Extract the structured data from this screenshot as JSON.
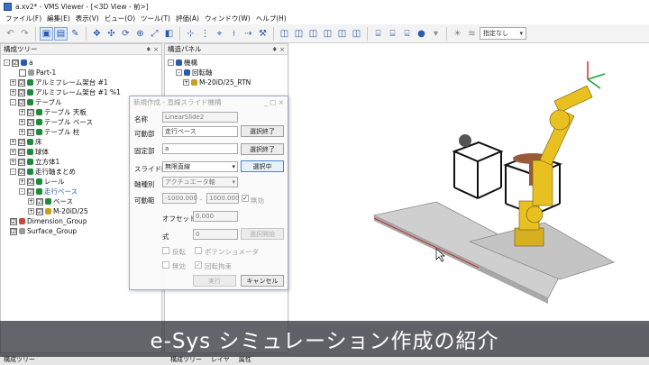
{
  "window": {
    "title": "a.xv2* - VMS Viewer - [<3D View - 前>]"
  },
  "menu": [
    "ファイル(F)",
    "編集(E)",
    "表示(V)",
    "ビュー(O)",
    "ツール(T)",
    "評価(A)",
    "ウィンドウ(W)",
    "ヘルプ(H)"
  ],
  "toolbar": {
    "select_value": "指定なし",
    "select_arrow": "▾"
  },
  "left_panel": {
    "title": "構成ツリー",
    "pin": "♦ ×",
    "items": [
      {
        "label": "a",
        "state": "☑"
      },
      {
        "label": "Part-1",
        "state": ""
      },
      {
        "label": "アルミフレーム架台 #1",
        "state": "☑"
      },
      {
        "label": "アルミフレーム架台 #1 %1",
        "state": "☑"
      },
      {
        "label": "テーブル",
        "state": "☑"
      },
      {
        "label": "テーブル 天板",
        "state": "☑"
      },
      {
        "label": "テーブル ベース",
        "state": "☑"
      },
      {
        "label": "テーブル 柱",
        "state": "☑"
      },
      {
        "label": "床",
        "state": "☑"
      },
      {
        "label": "球体",
        "state": "☑"
      },
      {
        "label": "立方体1",
        "state": "☑"
      },
      {
        "label": "走行軸まとめ",
        "state": "☑"
      },
      {
        "label": "レール",
        "state": "☑"
      },
      {
        "label": "走行ベース",
        "state": "☑"
      },
      {
        "label": "ベース",
        "state": "☑"
      },
      {
        "label": "M-20iD/25",
        "state": "☑"
      },
      {
        "label": "Dimension_Group",
        "state": "☑"
      },
      {
        "label": "Surface_Group",
        "state": "☑"
      }
    ]
  },
  "struct_panel": {
    "title": "構造パネル",
    "pin": "♦ ×",
    "items": [
      {
        "label": "機構"
      },
      {
        "label": "回転軸"
      },
      {
        "label": "M-20iD/25_RTN"
      }
    ]
  },
  "dialog": {
    "title": "新規作成 - 直線スライド機構",
    "name_label": "名称",
    "name_value": "LinearSlide2",
    "movable_label": "可動部",
    "movable_value": "走行ベース",
    "movable_btn": "選択終了",
    "fixed_label": "固定部",
    "fixed_value": "a",
    "fixed_btn": "選択終了",
    "axis_label": "スライド軸",
    "axis_value": "無限直線",
    "axis_btn": "選択中",
    "axis_type_label": "軸種別",
    "axis_type_value": "アクチュエータ軸",
    "range_label": "可動範",
    "range_min": "-1000.000",
    "range_dash": "–",
    "range_max": "1000.000",
    "range_check": "無効",
    "offset_label": "オフセット",
    "offset_value": "0.000",
    "formula_label": "式",
    "formula_value": "0",
    "formula_btn": "選択開始",
    "reverse_label": "反転",
    "potentiometer_label": "ポテンショメータ",
    "disable_label": "無効",
    "rotation_lock_label": "回転拘束",
    "ok_btn": "実行",
    "cancel_btn": "キャンセル"
  },
  "bottom_tabs": [
    "構成ツリー",
    "構成ツリー",
    "レイヤ",
    "属性"
  ],
  "caption": "e-Sys シミュレーション作成の紹介",
  "colors": {
    "robot": "#e8c020",
    "floor": "#c8c8c8",
    "accent": "#3c7fd6"
  }
}
